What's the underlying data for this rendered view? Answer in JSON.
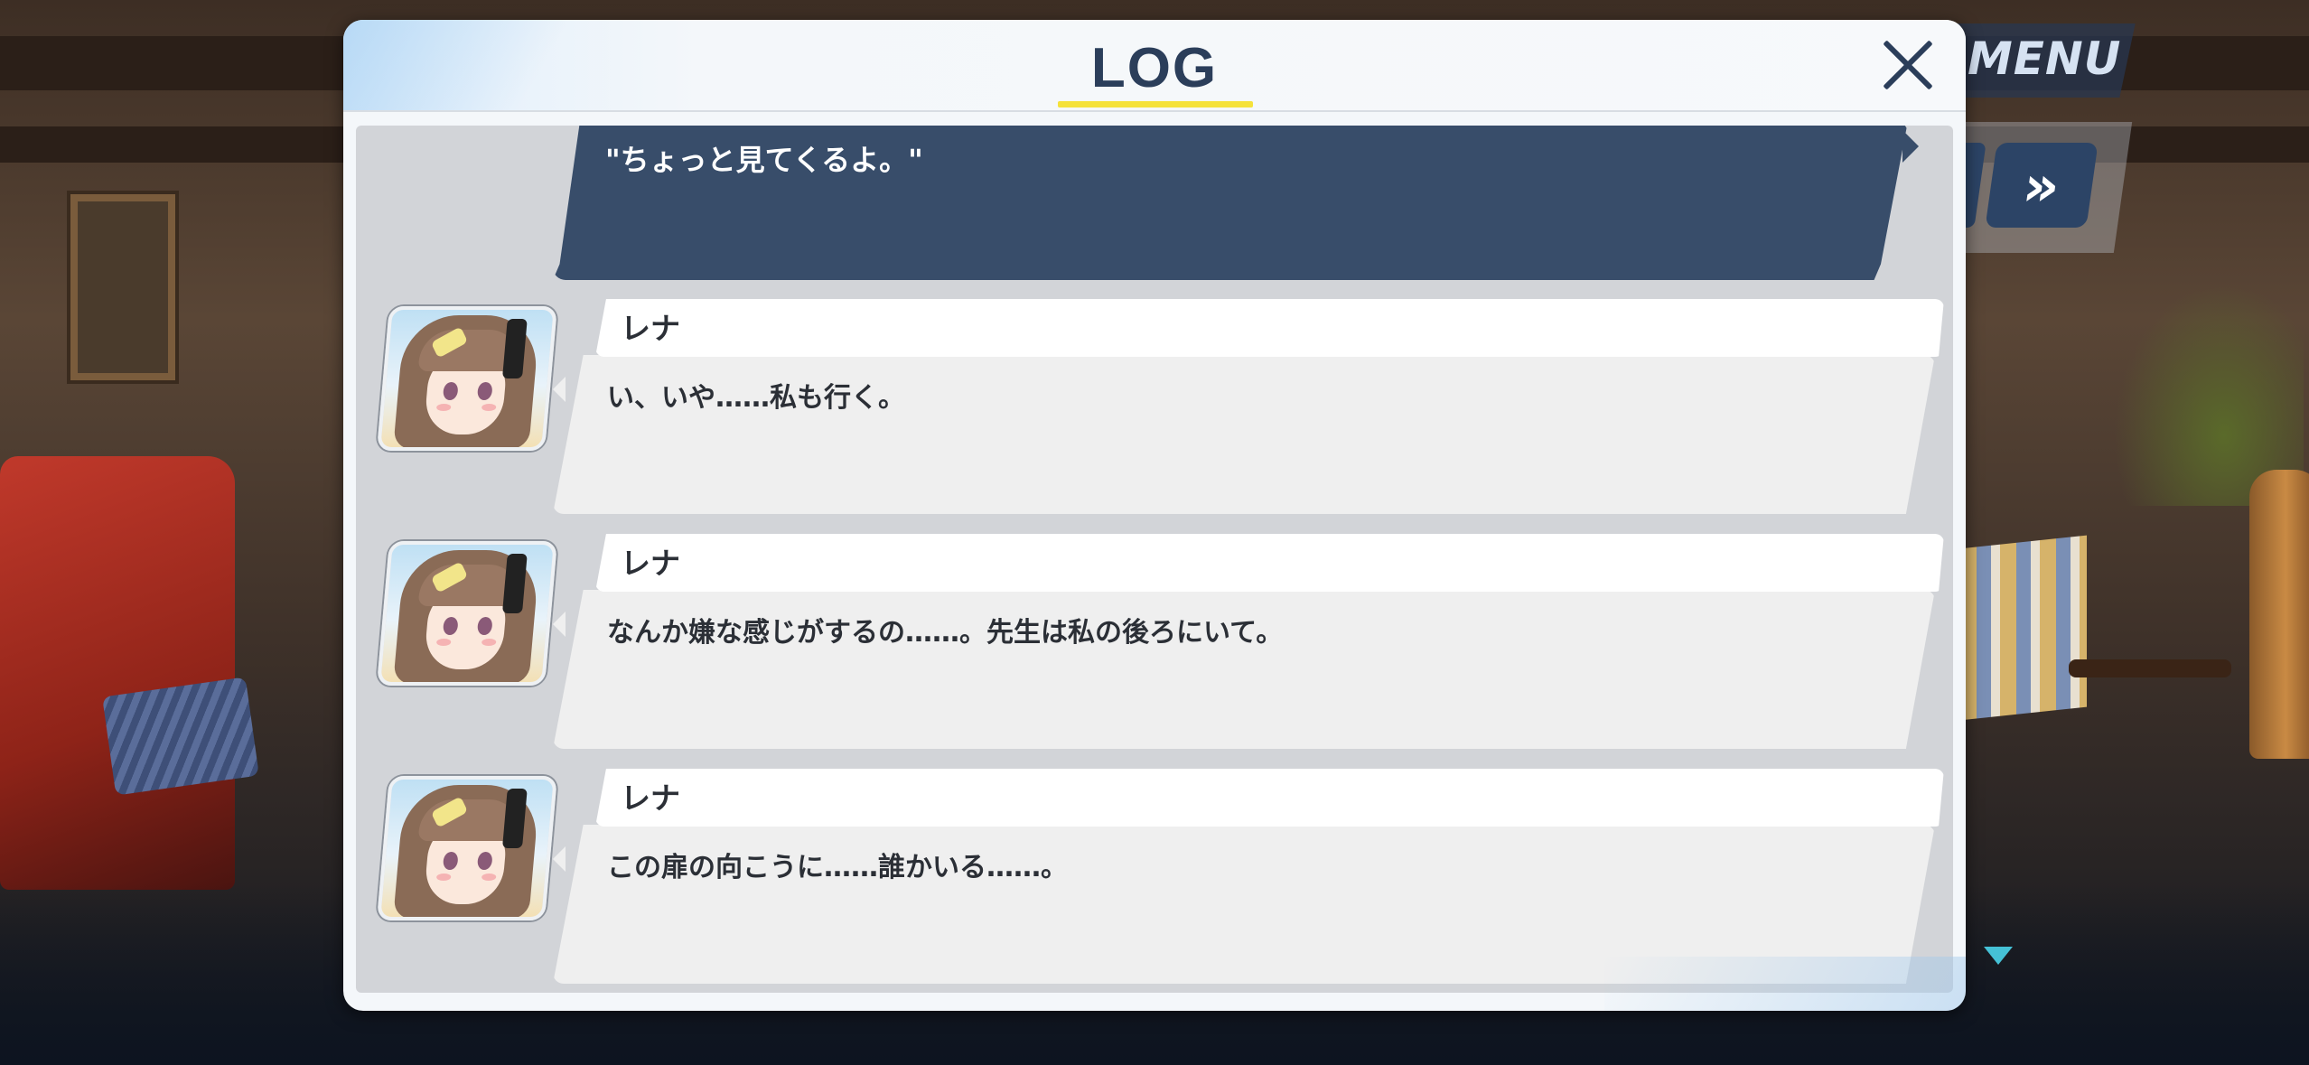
{
  "hud": {
    "menu_label": "MENU",
    "fast_forward_label": "»"
  },
  "log": {
    "title": "LOG",
    "player_line": "\"ちょっと見てくるよ。\"",
    "entries": [
      {
        "name": "レナ",
        "text": "い、いや……私も行く。"
      },
      {
        "name": "レナ",
        "text": "なんか嫌な感じがするの……。先生は私の後ろにいて。"
      },
      {
        "name": "レナ",
        "text": "この扉の向こうに……誰かいる……。"
      }
    ]
  },
  "colors": {
    "accent_yellow": "#f5e23a",
    "player_bubble": "#384d6a",
    "title_navy": "#2b3e5a",
    "next_indicator": "#45c1d6"
  },
  "icons": {
    "close": "close-icon",
    "fast_forward": "fast-forward-icon",
    "next": "next-indicator-icon"
  }
}
